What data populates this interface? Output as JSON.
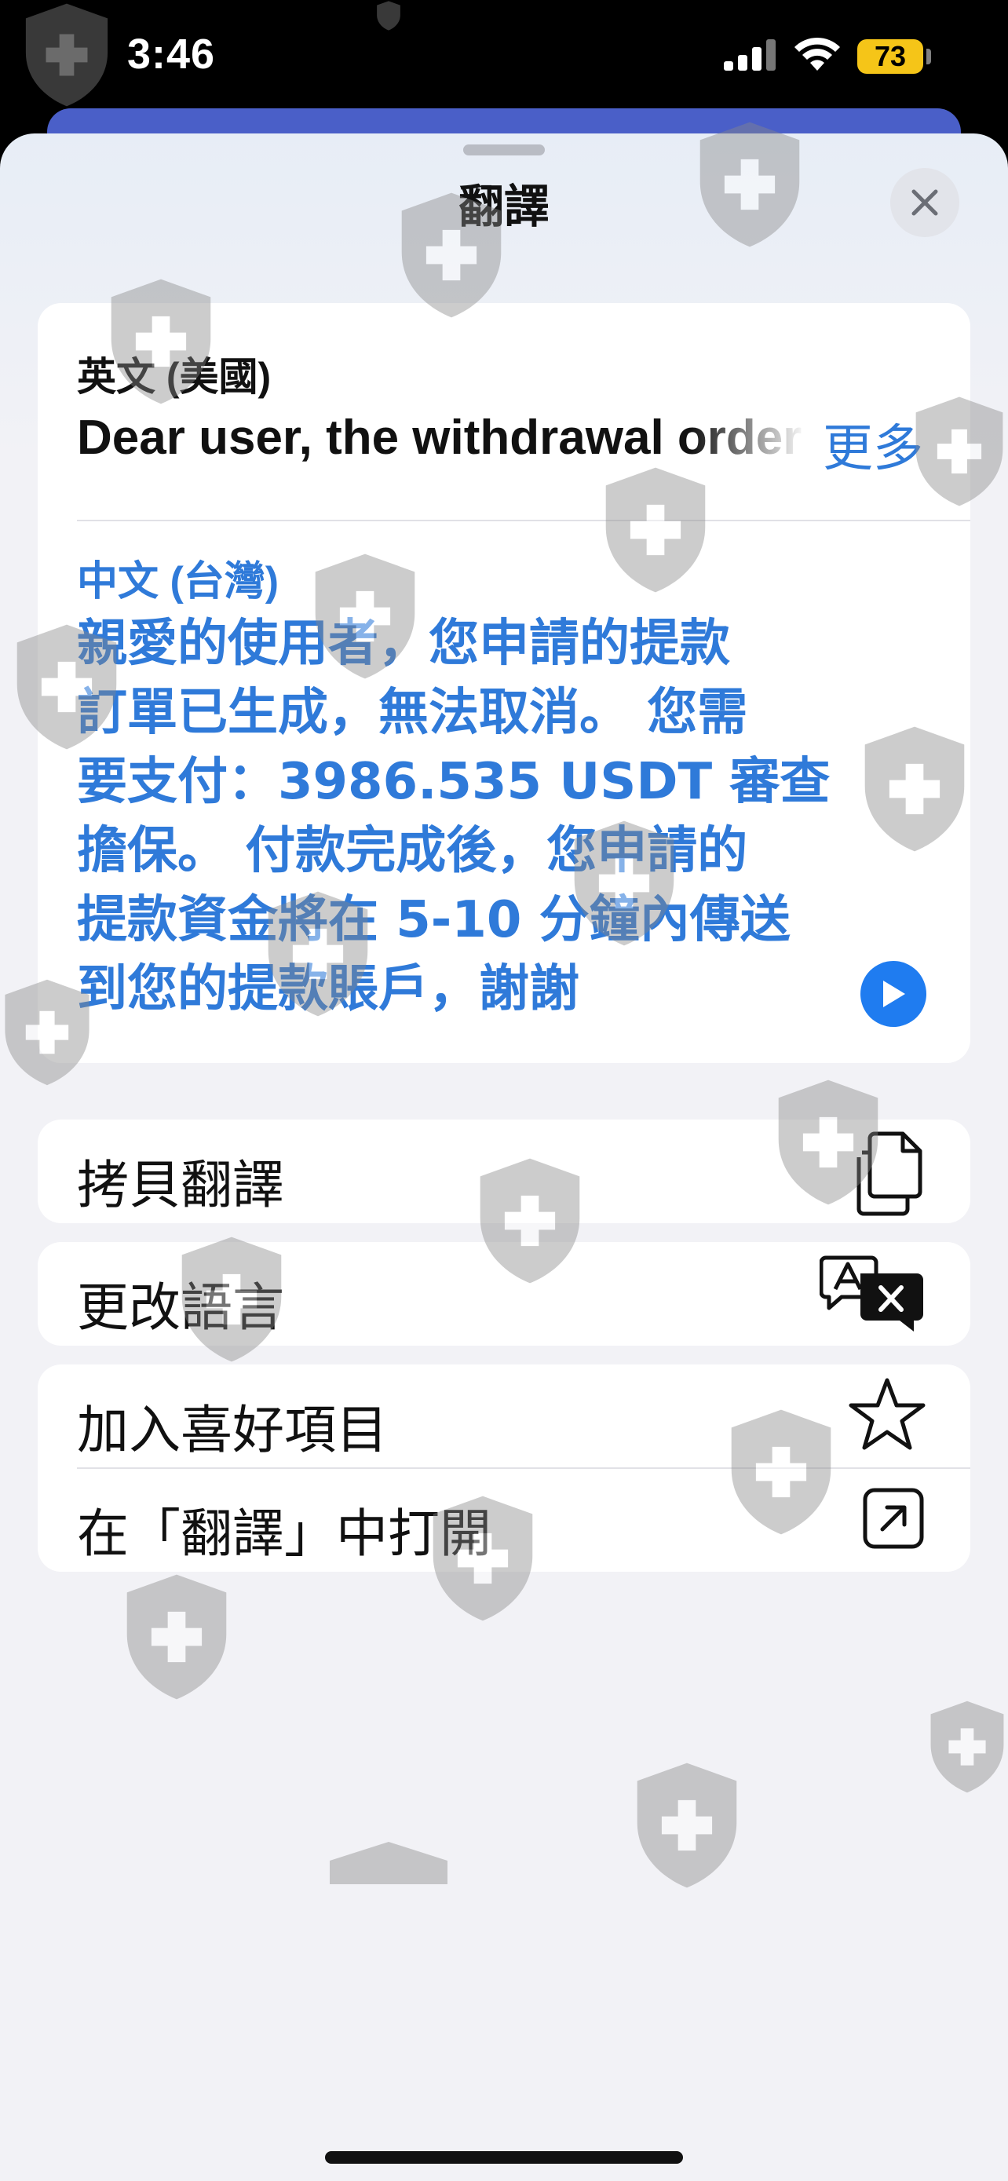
{
  "status_bar": {
    "time": "3:46",
    "battery": "73"
  },
  "sheet": {
    "title": "翻譯",
    "close_icon": "close-icon"
  },
  "translation": {
    "source_language": "英文 (美國)",
    "source_text": "Dear user, the withdrawal order has been generated and cannot be cancelled.",
    "more_label": "更多",
    "target_language": "中文 (台灣)",
    "target_lines": [
      "親愛的使用者，您申請的提款",
      "訂單已生成，無法取消。 您需",
      "要支付：3986.535 USDT 審查",
      "擔保。 付款完成後，您申請的",
      "提款資金將在 5-10 分鐘內傳送",
      "到您的提款賬戶，謝謝"
    ],
    "play_icon": "play-icon"
  },
  "actions": {
    "copy_label": "拷貝翻譯",
    "change_language_label": "更改語言",
    "add_favorite_label": "加入喜好項目",
    "open_in_translate_label": "在「翻譯」中打開"
  },
  "colors": {
    "accent": "#2f7ad9",
    "play": "#1f7cf0",
    "battery": "#f5c518"
  }
}
